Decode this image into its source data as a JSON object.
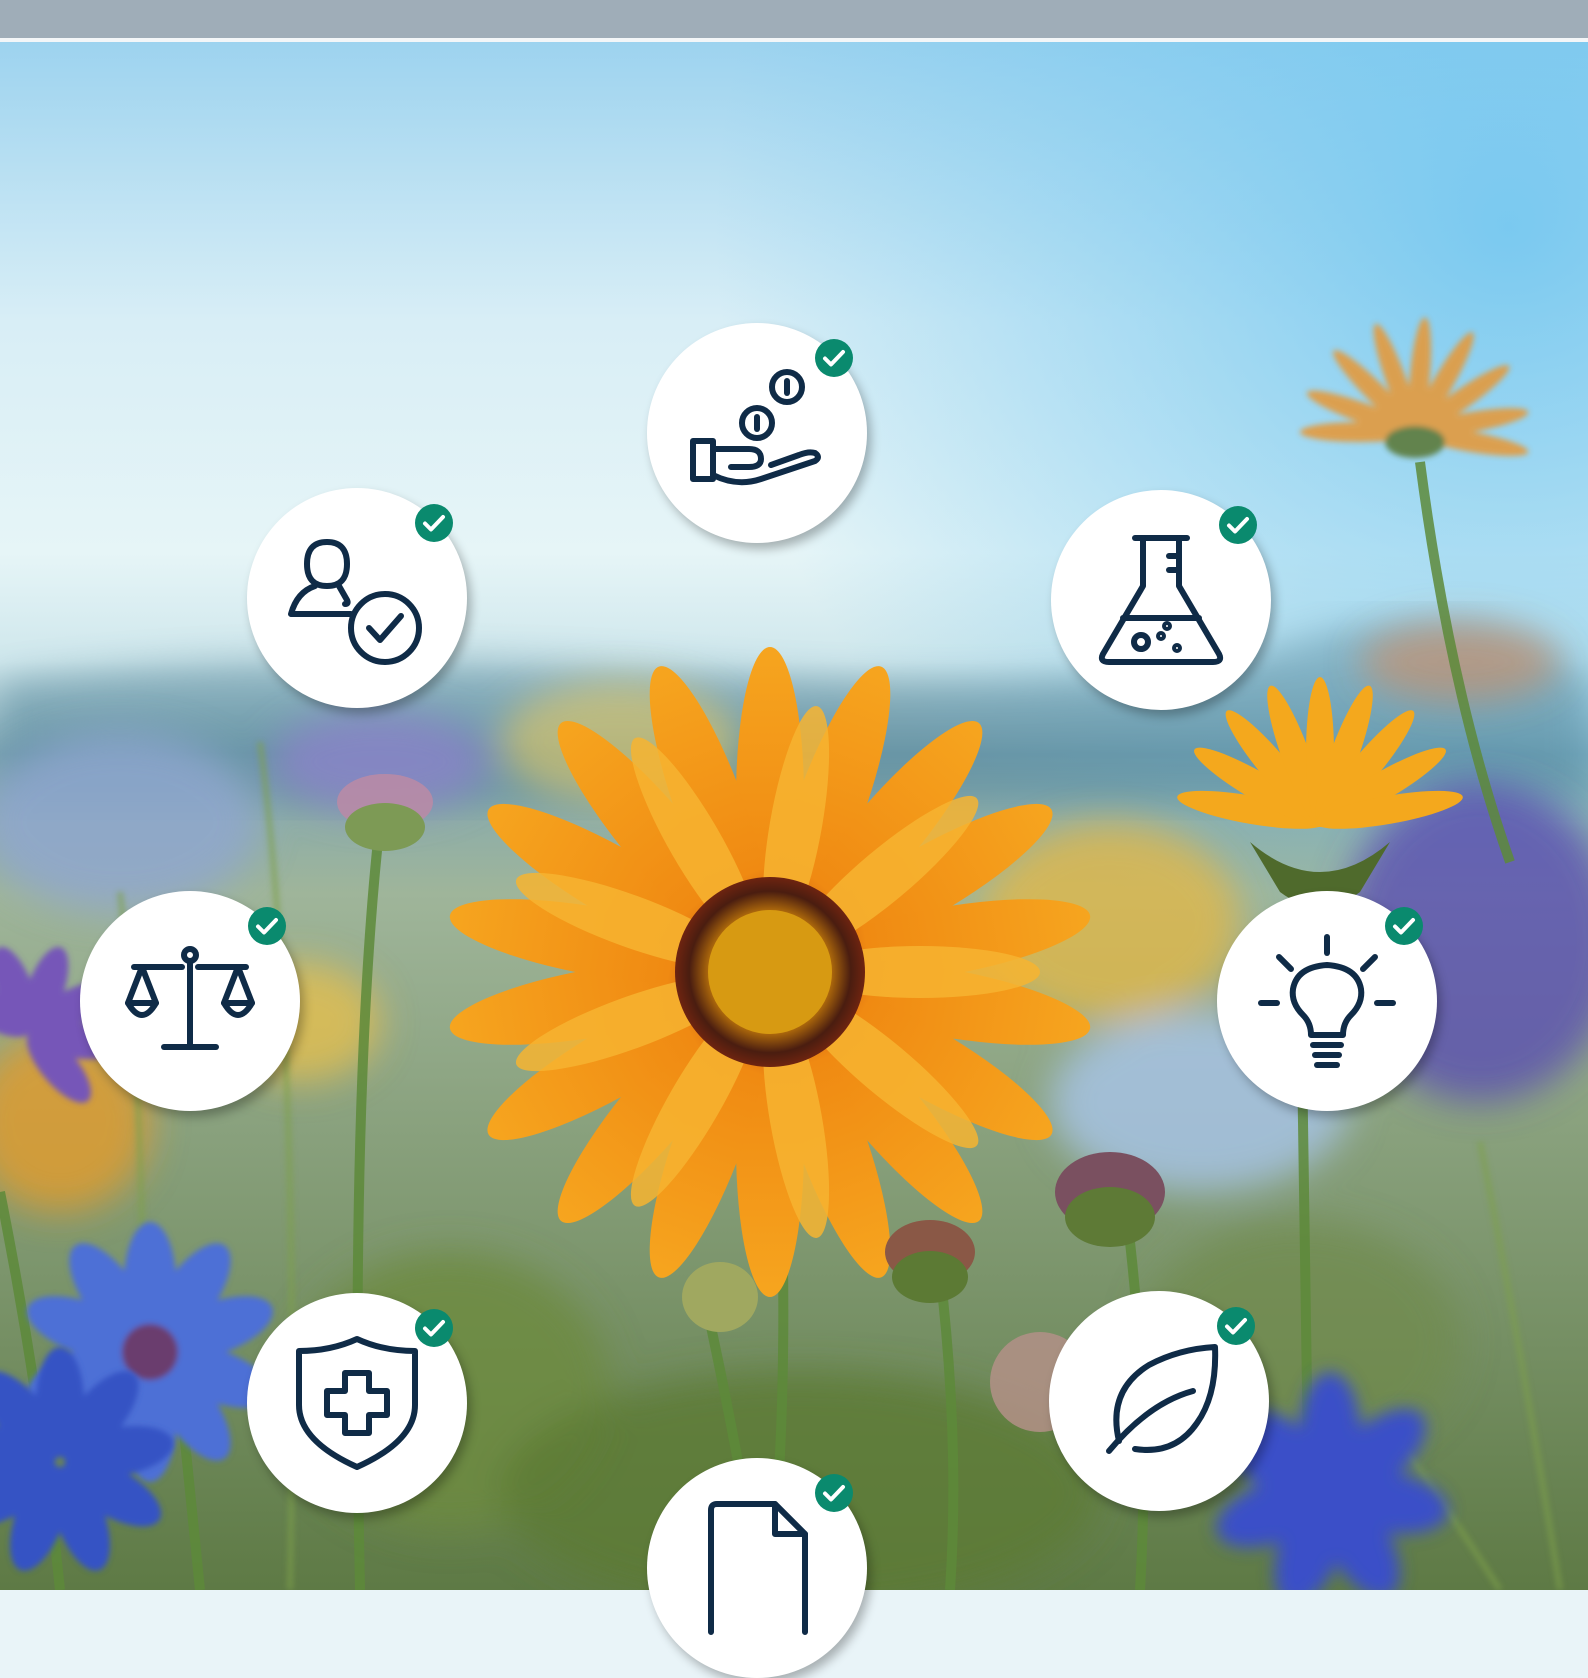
{
  "colors": {
    "top_bar": "#9fadb8",
    "badge_background": "#ffffff",
    "icon_stroke": "#0f2b47",
    "check_badge": "#0a8a6e",
    "check_mark": "#ffffff"
  },
  "badges": [
    {
      "icon": "hand-coins-icon",
      "checked": true
    },
    {
      "icon": "user-check-icon",
      "checked": true
    },
    {
      "icon": "flask-icon",
      "checked": true
    },
    {
      "icon": "scales-icon",
      "checked": true
    },
    {
      "icon": "lightbulb-icon",
      "checked": true
    },
    {
      "icon": "shield-plus-icon",
      "checked": true
    },
    {
      "icon": "leaf-icon",
      "checked": true
    },
    {
      "icon": "document-icon",
      "checked": true
    }
  ]
}
